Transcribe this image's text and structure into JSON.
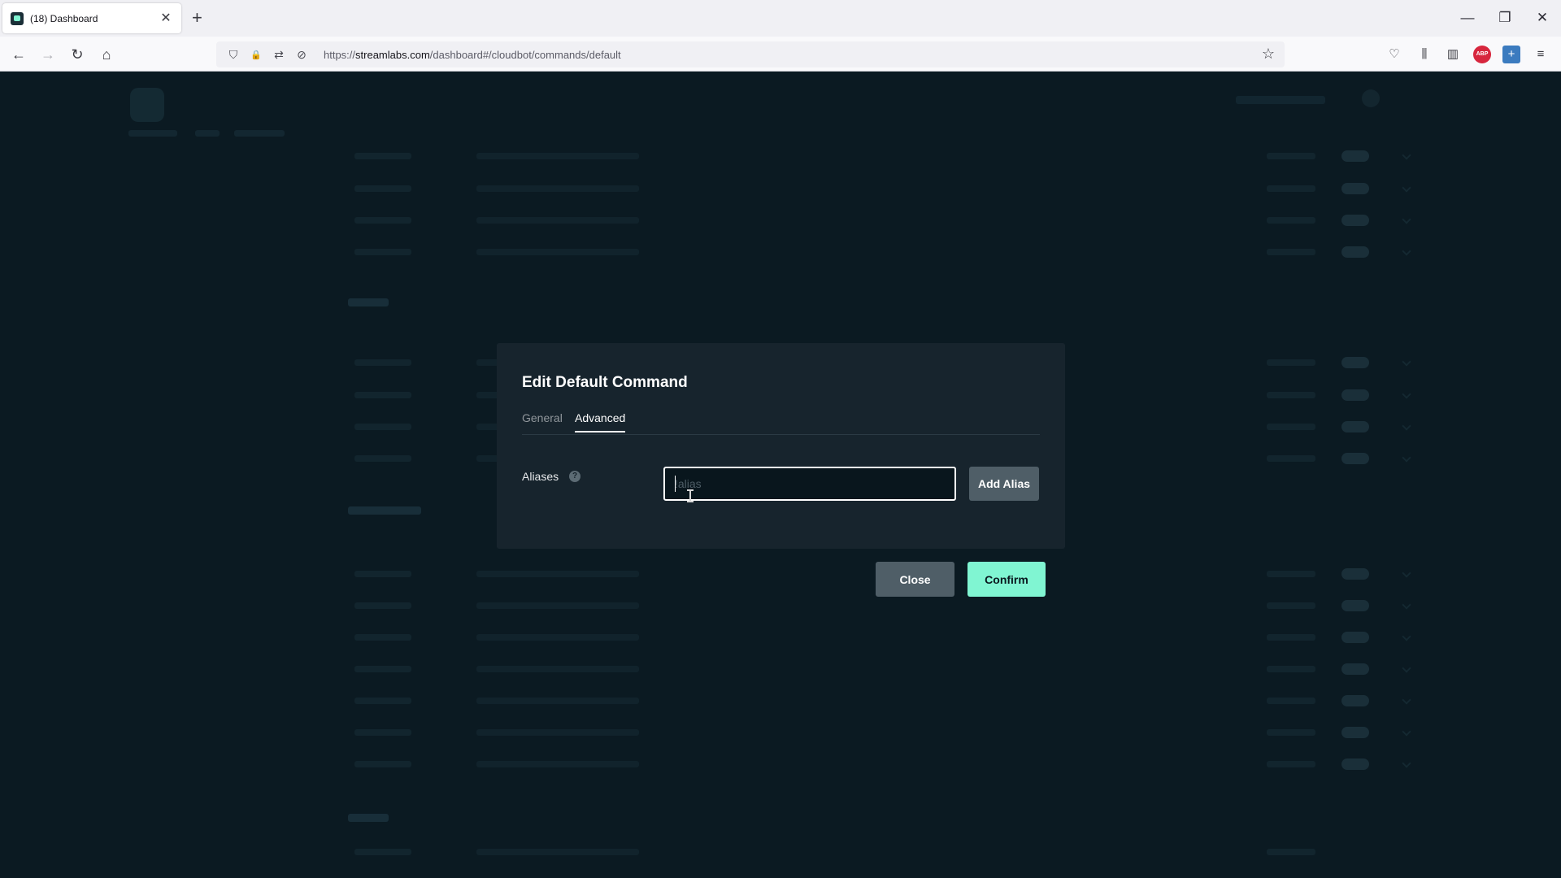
{
  "browser": {
    "tab": {
      "title": "(18) Dashboard",
      "favicon": "streamlabs-icon",
      "close_glyph": "✕"
    },
    "new_tab_glyph": "+",
    "window_controls": {
      "minimize": "—",
      "restore": "❐",
      "close": "✕"
    },
    "url": {
      "prefix": "https://",
      "host": "streamlabs.com",
      "path": "/dashboard#/cloudbot/commands/default"
    },
    "nav_glyphs": {
      "back": "←",
      "forward": "→",
      "reload": "↻",
      "home": "⌂"
    },
    "url_icons": {
      "shield": "⛉",
      "lock": "🔒",
      "permissions": "⇄",
      "tracking": "⊘"
    },
    "bookmark_glyph": "☆",
    "toolbar": {
      "pocket": "♡",
      "library": "⫼",
      "sidebar": "▥",
      "adblock_label": "ABP",
      "extension": "+",
      "menu": "≡"
    }
  },
  "modal": {
    "title": "Edit Default Command",
    "tabs": [
      {
        "label": "General",
        "active": false
      },
      {
        "label": "Advanced",
        "active": true
      }
    ],
    "aliases": {
      "label": "Aliases",
      "help_glyph": "?",
      "input_value": "",
      "input_placeholder": "!alias",
      "add_button": "Add Alias"
    },
    "buttons": {
      "close": "Close",
      "confirm": "Confirm"
    }
  },
  "colors": {
    "accent": "#80f5d2",
    "background": "#09161d",
    "modal": "#17242d",
    "secondary_button": "#4f5e67"
  }
}
